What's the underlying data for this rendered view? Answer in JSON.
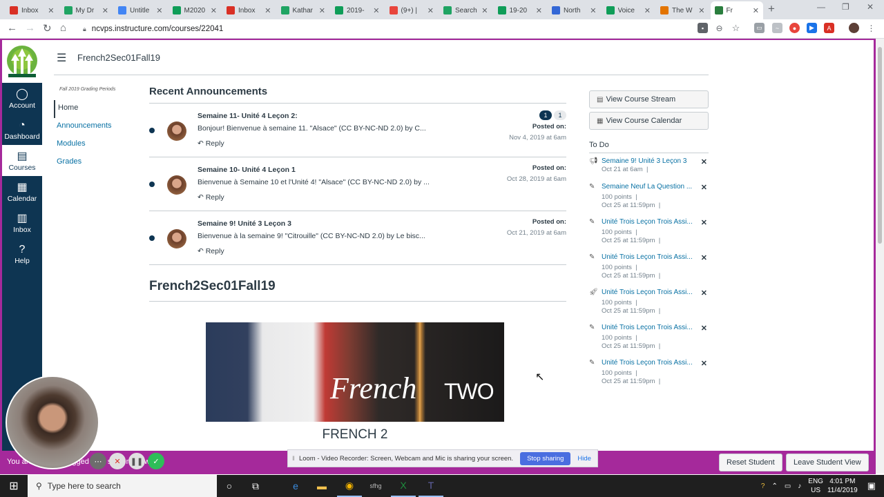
{
  "browser": {
    "tabs": [
      {
        "title": "Inbox",
        "color": "#d93025"
      },
      {
        "title": "My Dr",
        "color": "#1fa463"
      },
      {
        "title": "Untitle",
        "color": "#4285f4"
      },
      {
        "title": "M2020",
        "color": "#0f9d58"
      },
      {
        "title": "Inbox",
        "color": "#d93025"
      },
      {
        "title": "Kathar",
        "color": "#1fa463"
      },
      {
        "title": "2019-",
        "color": "#0f9d58"
      },
      {
        "title": "(9+) |",
        "color": "#e8453c"
      },
      {
        "title": "Search",
        "color": "#1fa463"
      },
      {
        "title": "19-20",
        "color": "#0f9d58"
      },
      {
        "title": "North",
        "color": "#3367d6"
      },
      {
        "title": "Voice",
        "color": "#0f9d58"
      },
      {
        "title": "The W",
        "color": "#e37400"
      },
      {
        "title": "Fr",
        "color": "#2a7e3e"
      }
    ],
    "new_tab": "+",
    "url": "ncvps.instructure.com/courses/22041"
  },
  "global_nav": {
    "items": [
      {
        "label": "Account",
        "icon": "◯"
      },
      {
        "label": "Dashboard",
        "icon": "◔"
      },
      {
        "label": "Courses",
        "icon": "▤"
      },
      {
        "label": "Calendar",
        "icon": "▦"
      },
      {
        "label": "Inbox",
        "icon": "▥"
      },
      {
        "label": "Help",
        "icon": "?"
      }
    ]
  },
  "header": {
    "breadcrumb": "French2Sec01Fall19"
  },
  "course_nav": {
    "grading_periods": "Fall 2019 Grading Periods",
    "items": [
      "Home",
      "Announcements",
      "Modules",
      "Grades"
    ]
  },
  "main": {
    "recent_title": "Recent Announcements",
    "announcements": [
      {
        "title": "Semaine 11- Unité 4 Leçon 2:",
        "body": "Bonjour! Bienvenue à semaine 11.  \"Alsace\" (CC BY-NC-ND 2.0) by C...",
        "reply": "Reply",
        "posted_label": "Posted on:",
        "date": "Nov 4, 2019 at 6am",
        "badge_unread": "1",
        "badge_total": "1"
      },
      {
        "title": "Semaine 10- Unité 4 Leçon 1",
        "body": "Bienvenue à Semaine 10 et l'Unité 4! \"Alsace\" (CC BY-NC-ND 2.0) by ...",
        "reply": "Reply",
        "posted_label": "Posted on:",
        "date": "Oct 28, 2019 at 6am"
      },
      {
        "title": "Semaine 9! Unité 3 Leçon 3",
        "body": "Bienvenue à la semaine 9! \"Citrouille\" (CC BY-NC-ND 2.0) by Le bisc...",
        "reply": "Reply",
        "posted_label": "Posted on:",
        "date": "Oct 21, 2019 at 6am"
      }
    ],
    "course_heading": "French2Sec01Fall19",
    "banner_text": "French",
    "banner_text2": "TWO",
    "banner_caption": "FRENCH 2"
  },
  "sidebar": {
    "view_stream": "View Course Stream",
    "view_calendar": "View Course Calendar",
    "todo_title": "To Do",
    "todos": [
      {
        "title": "Semaine 9! Unité 3 Leçon 3",
        "points": "",
        "date": "Oct 21 at 6am",
        "icon": "announcement-icon"
      },
      {
        "title": "Semaine Neuf La Question ...",
        "points": "100 points",
        "date": "Oct 25 at 11:59pm",
        "icon": "assignment-icon"
      },
      {
        "title": "Unité Trois Leçon Trois Assi...",
        "points": "100 points",
        "date": "Oct 25 at 11:59pm",
        "icon": "assignment-icon"
      },
      {
        "title": "Unité Trois Leçon Trois Assi...",
        "points": "100 points",
        "date": "Oct 25 at 11:59pm",
        "icon": "assignment-icon"
      },
      {
        "title": "Unité Trois Leçon Trois Assi...",
        "points": "100 points",
        "date": "Oct 25 at 11:59pm",
        "icon": "quiz-icon"
      },
      {
        "title": "Unité Trois Leçon Trois Assi...",
        "points": "100 points",
        "date": "Oct 25 at 11:59pm",
        "icon": "assignment-icon"
      },
      {
        "title": "Unité Trois Leçon Trois Assi...",
        "points": "100 points",
        "date": "Oct 25 at 11:59pm",
        "icon": "assignment-icon"
      }
    ]
  },
  "student_bar": {
    "left_text": "You are currently logged in to student view",
    "reset": "Reset Student",
    "leave": "Leave Student View"
  },
  "loom": {
    "message": "Loom - Video Recorder: Screen, Webcam and Mic is sharing your screen.",
    "stop": "Stop sharing",
    "hide": "Hide"
  },
  "taskbar": {
    "search_placeholder": "Type here to search",
    "lang": "ENG",
    "region": "US",
    "time": "4:01 PM",
    "date": "11/4/2019"
  }
}
